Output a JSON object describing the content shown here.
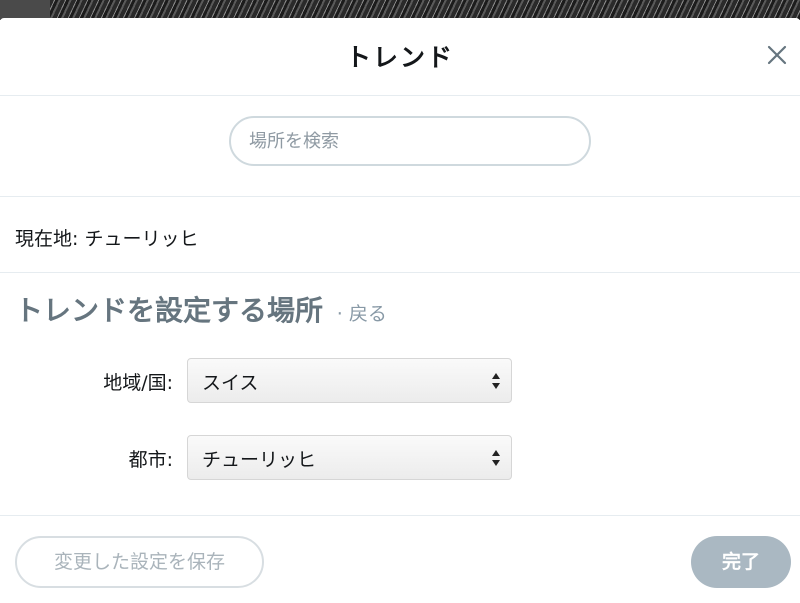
{
  "modal": {
    "title": "トレンド",
    "close_icon": "close-icon"
  },
  "search": {
    "placeholder": "場所を検索",
    "value": ""
  },
  "current": {
    "label": "現在地: チューリッヒ"
  },
  "settings": {
    "heading": "トレンドを設定する場所",
    "back_link": "· 戻る",
    "region_label": "地域/国:",
    "region_value": "スイス",
    "city_label": "都市:",
    "city_value": "チューリッヒ"
  },
  "footer": {
    "save_label": "変更した設定を保存",
    "done_label": "完了"
  },
  "colors": {
    "text": "#14171a",
    "heading": "#66757f",
    "muted": "#8899a6",
    "done_button": "#aab8c2",
    "divider": "#e6ecf0"
  }
}
